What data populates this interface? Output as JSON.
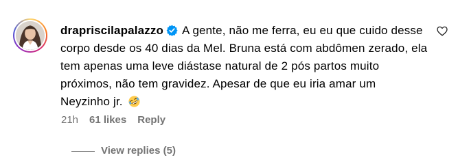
{
  "comment": {
    "username": "drapriscilapalazzo",
    "text": "A gente, não me ferra, eu eu que cuido desse corpo desde os 40 dias da Mel. Bruna está com abdômen zerado, ela tem apenas uma leve diástase natural de 2 pós partos muito próximos, não tem gravidez. Apesar de que eu iria amar um Neyzinho jr.",
    "emoji": "rolling-on-the-floor-laughing",
    "time": "21h",
    "likes": "61 likes",
    "reply_label": "Reply",
    "view_replies_label": "View replies (5)",
    "icons": {
      "verified": "verified-badge-icon",
      "like": "heart-outline-icon"
    },
    "colors": {
      "verified_blue": "#0095f6",
      "meta_gray": "#737373",
      "text": "#000000"
    }
  }
}
